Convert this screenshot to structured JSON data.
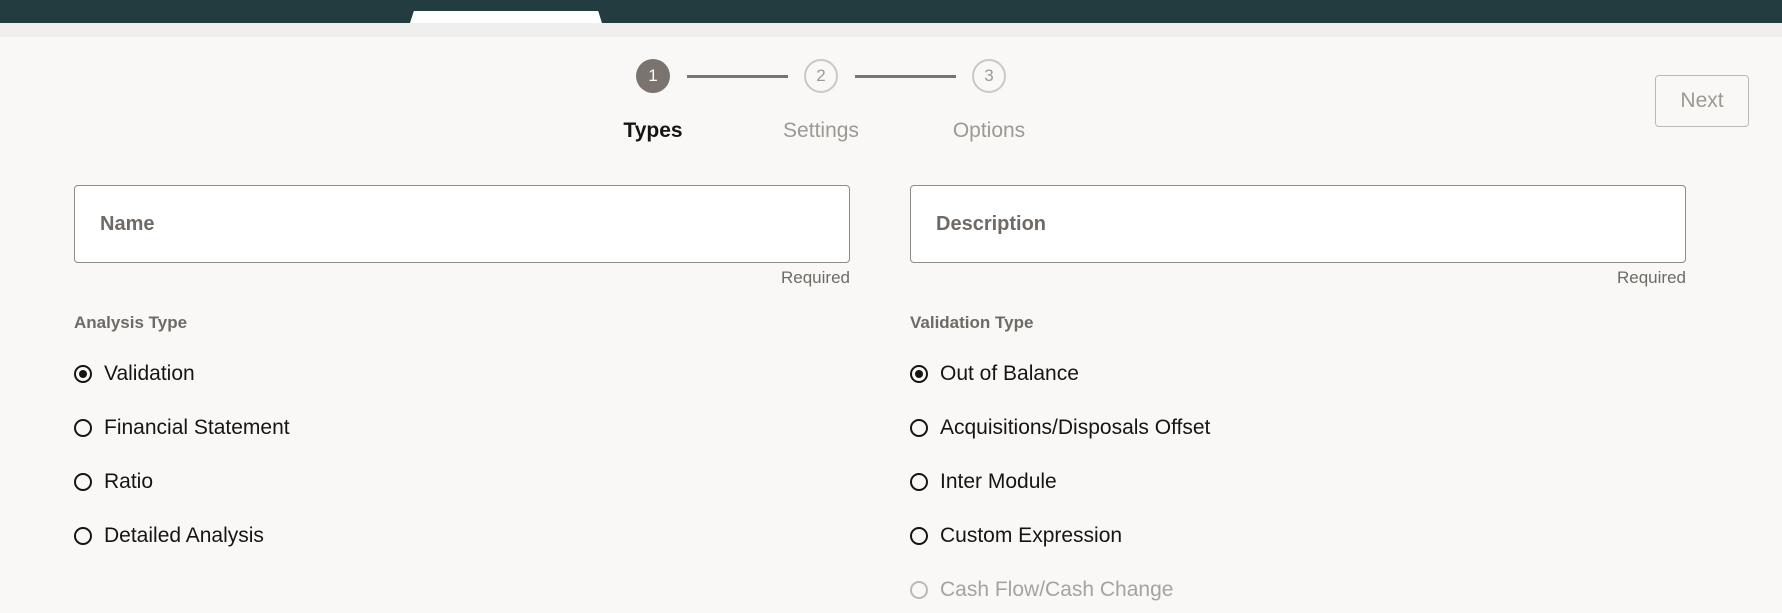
{
  "wizard": {
    "steps": [
      {
        "number": "1",
        "label": "Types",
        "state": "active"
      },
      {
        "number": "2",
        "label": "Settings",
        "state": "inactive"
      },
      {
        "number": "3",
        "label": "Options",
        "state": "inactive"
      }
    ],
    "next_label": "Next"
  },
  "form": {
    "name": {
      "placeholder": "Name",
      "value": "",
      "hint": "Required"
    },
    "description": {
      "placeholder": "Description",
      "value": "",
      "hint": "Required"
    }
  },
  "analysis_type": {
    "label": "Analysis Type",
    "options": [
      {
        "label": "Validation",
        "checked": true
      },
      {
        "label": "Financial Statement",
        "checked": false
      },
      {
        "label": "Ratio",
        "checked": false
      },
      {
        "label": "Detailed Analysis",
        "checked": false
      }
    ]
  },
  "validation_type": {
    "label": "Validation Type",
    "options": [
      {
        "label": "Out of Balance",
        "checked": true
      },
      {
        "label": "Acquisitions/Disposals Offset",
        "checked": false
      },
      {
        "label": "Inter Module",
        "checked": false
      },
      {
        "label": "Custom Expression",
        "checked": false
      },
      {
        "label": "Cash Flow/Cash Change",
        "checked": false,
        "disabled": true
      }
    ]
  },
  "colors": {
    "header": "#233c40",
    "background": "#f9f8f6",
    "active_step": "#7a736e"
  }
}
